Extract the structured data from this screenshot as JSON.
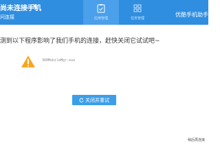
{
  "header": {
    "title": "尚未连接手机",
    "dropdown_icon": "chevron-down-icon",
    "sublink": "问连接",
    "tabs": [
      {
        "label": "应用管理",
        "icon": "clipboard-check-icon",
        "active": true
      },
      {
        "label": "任务管理",
        "icon": "grid-icon",
        "active": false
      }
    ],
    "brand": "优酷手机助手"
  },
  "dialog": {
    "message": "测到以下程序影响了我们手机的连接，赶快关闭它试试吧~",
    "warning_icon": "warning-icon",
    "process_name": "360MobileMgr.exe",
    "close_button_label": "关闭并重试",
    "refresh_icon": "refresh-icon"
  },
  "footer": {
    "link": "稍后再连接"
  },
  "colors": {
    "header_bg": "#2f8ee0",
    "button_bg": "#3d9ee8",
    "warning": "#f5a623"
  }
}
